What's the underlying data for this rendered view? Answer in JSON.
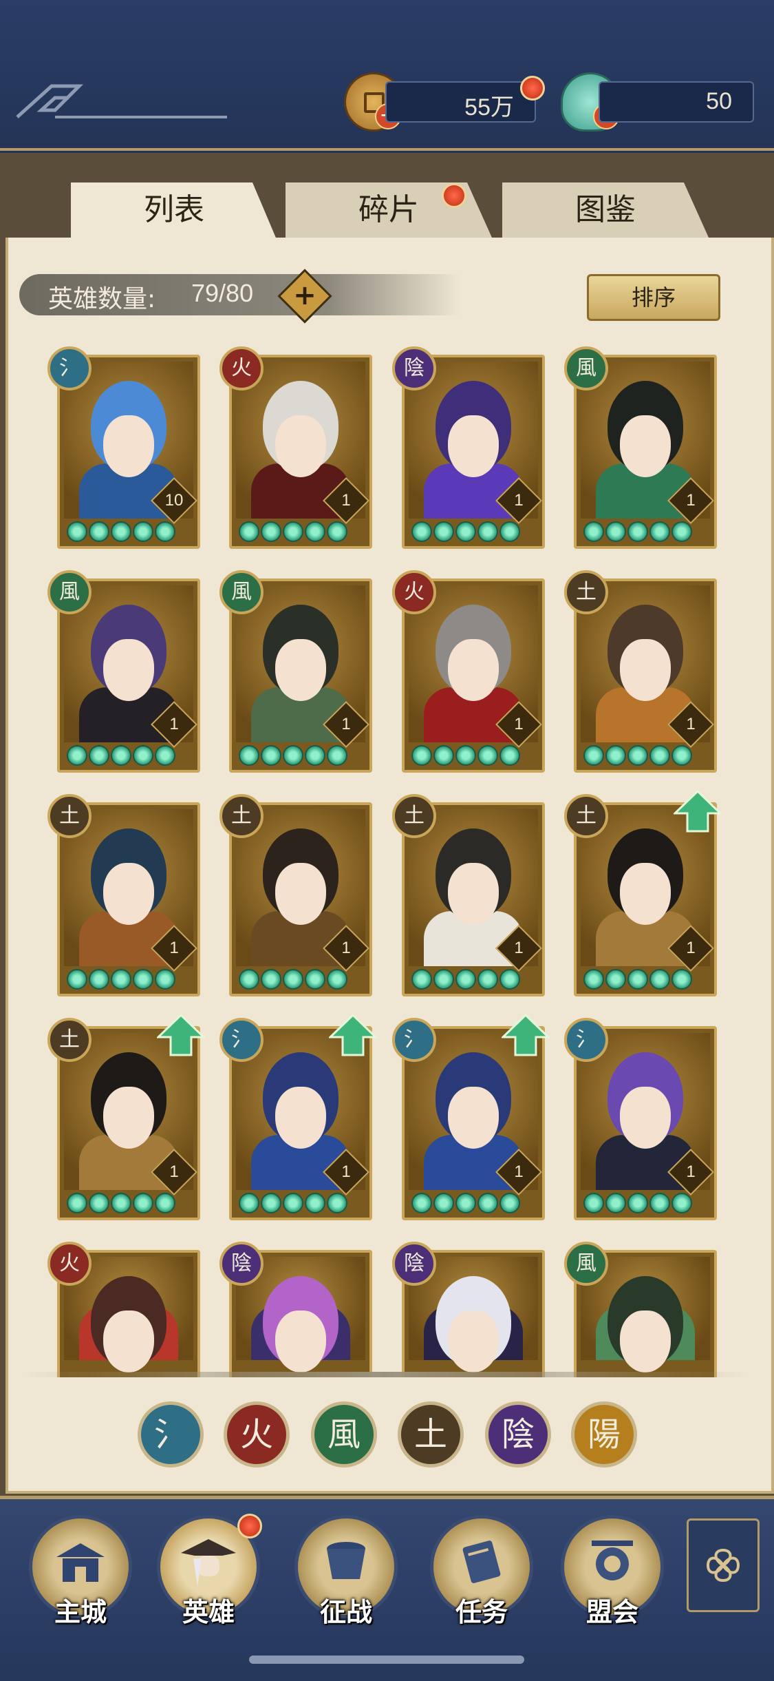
{
  "currency": {
    "coins": "55万",
    "jade": "50"
  },
  "tabs": [
    {
      "label": "列表",
      "active": true
    },
    {
      "label": "碎片",
      "active": false,
      "badge": true
    },
    {
      "label": "图鉴",
      "active": false
    }
  ],
  "hero_count": {
    "label": "英雄数量:",
    "value": "79/80",
    "add": "+"
  },
  "sort_label": "排序",
  "elements": {
    "water": {
      "glyph": "氵",
      "color": "#2f6f86"
    },
    "fire": {
      "glyph": "火",
      "color": "#8a2a22"
    },
    "yin": {
      "glyph": "陰",
      "color": "#4d2f78"
    },
    "wind": {
      "glyph": "風",
      "color": "#2c6e46"
    },
    "earth": {
      "glyph": "土",
      "color": "#4d3b24"
    },
    "yang": {
      "glyph": "陽",
      "color": "#b47f1c"
    }
  },
  "heroes": [
    {
      "element": "water",
      "level": "10",
      "stars": 5,
      "upgrade": false,
      "hair": "#4c8ad6",
      "outfit": "#2a5a9a"
    },
    {
      "element": "fire",
      "level": "1",
      "stars": 5,
      "upgrade": false,
      "hair": "#dcd8d2",
      "outfit": "#5a1a18"
    },
    {
      "element": "yin",
      "level": "1",
      "stars": 5,
      "upgrade": false,
      "hair": "#3f2f7a",
      "outfit": "#5b3ab8"
    },
    {
      "element": "wind",
      "level": "1",
      "stars": 5,
      "upgrade": false,
      "hair": "#1e2320",
      "outfit": "#2e7a55"
    },
    {
      "element": "wind",
      "level": "1",
      "stars": 5,
      "upgrade": false,
      "hair": "#4a3b78",
      "outfit": "#232026"
    },
    {
      "element": "wind",
      "level": "1",
      "stars": 5,
      "upgrade": false,
      "hair": "#2a3028",
      "outfit": "#4e6b4a"
    },
    {
      "element": "fire",
      "level": "1",
      "stars": 5,
      "upgrade": false,
      "hair": "#8d8a88",
      "outfit": "#9a1e1e"
    },
    {
      "element": "earth",
      "level": "1",
      "stars": 5,
      "upgrade": false,
      "hair": "#4e3a2a",
      "outfit": "#b8742a"
    },
    {
      "element": "earth",
      "level": "1",
      "stars": 5,
      "upgrade": false,
      "hair": "#223a52",
      "outfit": "#9a5a28"
    },
    {
      "element": "earth",
      "level": "1",
      "stars": 5,
      "upgrade": false,
      "hair": "#2c241c",
      "outfit": "#6a4a22"
    },
    {
      "element": "earth",
      "level": "1",
      "stars": 5,
      "upgrade": false,
      "hair": "#2c2a26",
      "outfit": "#e9e4da"
    },
    {
      "element": "earth",
      "level": "1",
      "stars": 5,
      "upgrade": true,
      "hair": "#1e1a18",
      "outfit": "#a37a3a"
    },
    {
      "element": "earth",
      "level": "1",
      "stars": 5,
      "upgrade": true,
      "hair": "#1e1a18",
      "outfit": "#a37a3a"
    },
    {
      "element": "water",
      "level": "1",
      "stars": 5,
      "upgrade": true,
      "hair": "#2a3a78",
      "outfit": "#2a4a9a"
    },
    {
      "element": "water",
      "level": "1",
      "stars": 5,
      "upgrade": true,
      "hair": "#2a3a78",
      "outfit": "#2a4a9a"
    },
    {
      "element": "water",
      "level": "1",
      "stars": 5,
      "upgrade": false,
      "hair": "#6a4ab0",
      "outfit": "#222638"
    },
    {
      "element": "fire",
      "level": "",
      "stars": 0,
      "upgrade": false,
      "hair": "#4a2a22",
      "outfit": "#b8362a"
    },
    {
      "element": "yin",
      "level": "",
      "stars": 0,
      "upgrade": false,
      "hair": "#b264c8",
      "outfit": "#3a2f6a"
    },
    {
      "element": "yin",
      "level": "",
      "stars": 0,
      "upgrade": false,
      "hair": "#e4e4ee",
      "outfit": "#2a2348"
    },
    {
      "element": "wind",
      "level": "",
      "stars": 0,
      "upgrade": false,
      "hair": "#2a3a2a",
      "outfit": "#4f8a5a"
    }
  ],
  "filters": [
    "water",
    "fire",
    "wind",
    "earth",
    "yin",
    "yang"
  ],
  "nav": [
    {
      "label": "主城",
      "active": false,
      "badge": false
    },
    {
      "label": "英雄",
      "active": true,
      "badge": true
    },
    {
      "label": "征战",
      "active": false,
      "badge": false
    },
    {
      "label": "任务",
      "active": false,
      "badge": false
    },
    {
      "label": "盟会",
      "active": false,
      "badge": false
    }
  ]
}
